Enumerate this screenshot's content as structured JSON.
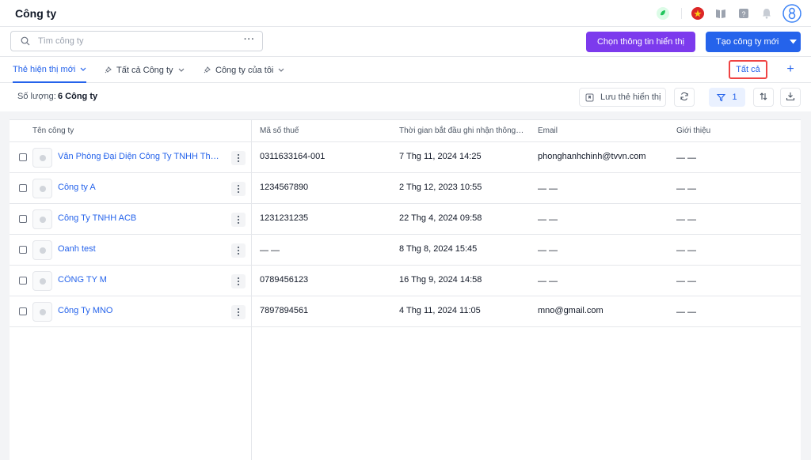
{
  "header": {
    "title": "Công ty"
  },
  "search": {
    "placeholder": "Tìm công ty",
    "more_label": "···"
  },
  "actions": {
    "select_fields_label": "Chọn thông tin hiển thị",
    "create_label": "Tạo công ty mới"
  },
  "tabs": [
    {
      "label": "Thẻ hiện thị mới",
      "active": true
    },
    {
      "label": "Tất cả Công ty",
      "active": false
    },
    {
      "label": "Công ty của tôi",
      "active": false
    }
  ],
  "all_tab_label": "Tất cả",
  "add_tab_label": "+",
  "summary": {
    "count_label": "Số lượng:",
    "count_value": "6 Công ty",
    "save_view_label": "Lưu thẻ hiển thị",
    "filter_count": "1"
  },
  "table": {
    "columns": [
      "Tên công ty",
      "Mã số thuế",
      "Thời gian bắt đầu ghi nhận thông tin",
      "Email",
      "Giới thiệu"
    ],
    "rows": [
      {
        "name": "Văn Phòng Đại Diện Công Ty TNHH Thương Mại",
        "tax": "0311633164-001",
        "time": "7 Thg 11, 2024 14:25",
        "email": "phonghanhchinh@tvvn.com",
        "intro": "— —"
      },
      {
        "name": "Công ty A",
        "tax": "1234567890",
        "time": "2 Thg 12, 2023 10:55",
        "email": "— —",
        "intro": "— —"
      },
      {
        "name": "Công Ty TNHH ACB",
        "tax": "1231231235",
        "time": "22 Thg 4, 2024 09:58",
        "email": "— —",
        "intro": "— —"
      },
      {
        "name": "Oanh test",
        "tax": "— —",
        "time": "8 Thg 8, 2024 15:45",
        "email": "— —",
        "intro": "— —"
      },
      {
        "name": "CÔNG TY M",
        "tax": "0789456123",
        "time": "16 Thg 9, 2024 14:58",
        "email": "— —",
        "intro": "— —"
      },
      {
        "name": "Công Ty MNO",
        "tax": "7897894561",
        "time": "4 Thg 11, 2024 11:05",
        "email": "mno@gmail.com",
        "intro": "— —"
      }
    ]
  },
  "icons": {
    "app": "leaf-icon",
    "flag": "vietnam-flag-icon",
    "book": "book-icon",
    "help": "help-icon",
    "bell": "bell-icon",
    "user": "user-avatar-icon",
    "refresh": "refresh-icon",
    "filter": "filter-icon",
    "sort": "sort-icon",
    "download": "download-icon"
  },
  "colors": {
    "primary": "#2563eb",
    "accent_purple": "#7c3aed",
    "highlight_red": "#ef4444"
  }
}
